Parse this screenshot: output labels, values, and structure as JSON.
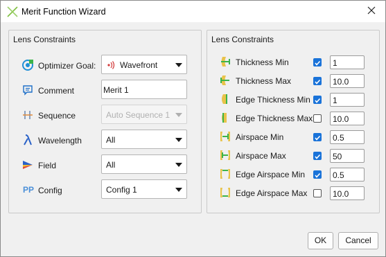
{
  "window": {
    "title": "Merit Function Wizard"
  },
  "left_panel": {
    "title": "Lens Constraints",
    "optimizer_goal": {
      "label": "Optimizer Goal:",
      "value": "Wavefront"
    },
    "comment": {
      "label": "Comment",
      "value": "Merit 1"
    },
    "sequence": {
      "label": "Sequence",
      "value": "Auto Sequence 1"
    },
    "wavelength": {
      "label": "Wavelength",
      "value": "All"
    },
    "field": {
      "label": "Field",
      "value": "All"
    },
    "config": {
      "label": "Config",
      "value": "Config 1",
      "icon_text": "PP"
    }
  },
  "right_panel": {
    "title": "Lens Constraints",
    "rows": [
      {
        "label": "Thickness Min",
        "checked": true,
        "value": "1"
      },
      {
        "label": "Thickness Max",
        "checked": true,
        "value": "10.0"
      },
      {
        "label": "Edge Thickness Min",
        "checked": true,
        "value": "1"
      },
      {
        "label": "Edge Thickness Max",
        "checked": false,
        "value": "10.0"
      },
      {
        "label": "Airspace Min",
        "checked": true,
        "value": "0.5"
      },
      {
        "label": "Airspace Max",
        "checked": true,
        "value": "50"
      },
      {
        "label": "Edge Airspace Min",
        "checked": true,
        "value": "0.5"
      },
      {
        "label": "Edge Airspace Max",
        "checked": false,
        "value": "10.0"
      }
    ]
  },
  "buttons": {
    "ok": "OK",
    "cancel": "Cancel"
  },
  "colors": {
    "accent": "#1a73d9",
    "icon_green": "#7fbf3f",
    "icon_yellow": "#e8c34a"
  }
}
